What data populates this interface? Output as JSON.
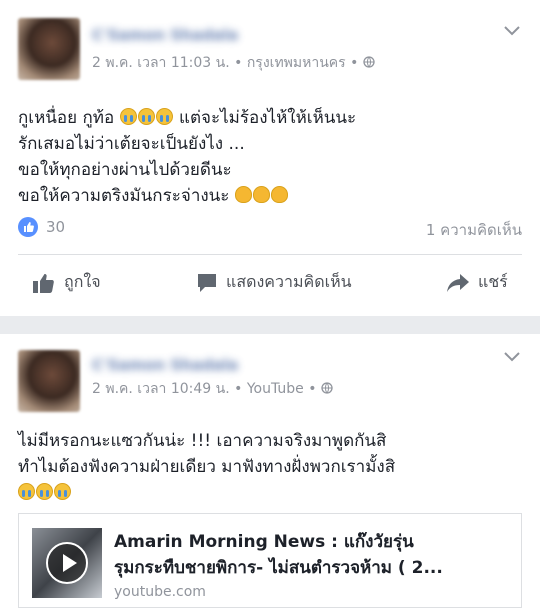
{
  "posts": [
    {
      "author": "C'Samon Shadala",
      "date": "2 พ.ค. เวลา 11:03 น.",
      "location": "กรุงเทพมหานคร",
      "sep": "•",
      "lines": [
        {
          "pre": "กูเหนื่อย กูท้อ ",
          "emoji": [
            "cry",
            "cry",
            "cry"
          ],
          "post": " แต่จะไม่ร้องไห้ให้เห็นนะ"
        },
        {
          "pre": "รักเสมอไม่ว่าเต้ยจะเป็นยังไง ...",
          "emoji": [],
          "post": ""
        },
        {
          "pre": "ขอให้ทุกอย่างผ่านไปด้วยดีนะ",
          "emoji": [],
          "post": ""
        },
        {
          "pre": "ขอให้ความตริงมันกระจ่างนะ ",
          "emoji": [
            "sweat",
            "sweat",
            "sweat"
          ],
          "post": ""
        }
      ],
      "like_count": "30",
      "comment_count": "1 ความคิดเห็น",
      "actions": {
        "like": "ถูกใจ",
        "comment": "แสดงความคิดเห็น",
        "share": "แชร์"
      }
    },
    {
      "author": "C'Samon Shadala",
      "date": "2 พ.ค. เวลา 10:49 น.",
      "source": "YouTube",
      "sep": "•",
      "lines": [
        {
          "pre": "ไม่มีหรอกนะแซวกันน่ะ !!! เอาความจริงมาพูดกันสิ",
          "emoji": [],
          "post": ""
        },
        {
          "pre": "ทำไมต้องฟังความฝ่ายเดียว มาฟังทางฝั่งพวกเรามั้งสิ",
          "emoji": [],
          "post": ""
        },
        {
          "pre": "",
          "emoji": [
            "cry",
            "cry",
            "cry"
          ],
          "post": ""
        }
      ],
      "link": {
        "title_line1": "Amarin Morning News : แก๊งวัยรุ่น",
        "title_line2": "รุมกระทืบชายพิการ- ไม่สนตำรวจห้าม ( 2...",
        "domain": "youtube.com"
      }
    }
  ],
  "icons": {
    "privacy": "globe-icon",
    "menu": "chevron-down-icon",
    "like": "thumbs-up-icon",
    "comment": "comment-bubble-icon",
    "share": "share-arrow-icon",
    "play": "play-icon"
  },
  "colors": {
    "link_blue": "#365899",
    "like_badge": "#5890ff",
    "muted": "#90949c",
    "action": "#4b4f56"
  }
}
